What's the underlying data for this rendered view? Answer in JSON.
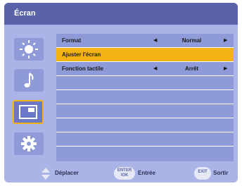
{
  "window": {
    "title": "Écran"
  },
  "sidebar": {
    "items": [
      {
        "icon": "brightness-icon",
        "selected": false
      },
      {
        "icon": "music-note-icon",
        "selected": false
      },
      {
        "icon": "screen-icon",
        "selected": true
      },
      {
        "icon": "gear-icon",
        "selected": false
      }
    ]
  },
  "menu": {
    "rows": [
      {
        "label": "Format",
        "value": "Normal",
        "arrows": true,
        "highlighted": false
      },
      {
        "label": "Ajuster l'écran",
        "value": "",
        "arrows": false,
        "highlighted": true
      },
      {
        "label": "Fonction tactile",
        "value": "Arrêt",
        "arrows": true,
        "highlighted": false
      }
    ],
    "arrow_left": "◀",
    "arrow_right": "▶"
  },
  "footer": {
    "move_label": "Déplacer",
    "enter_key_label": "ENTER /OK",
    "enter_label": "Entrée",
    "exit_key_label": "EXIT",
    "exit_label": "Sortir"
  },
  "colors": {
    "background": "#aab4e6",
    "titlebar": "#5a63a8",
    "row": "#8f9bd8",
    "highlight": "#f4b313"
  }
}
